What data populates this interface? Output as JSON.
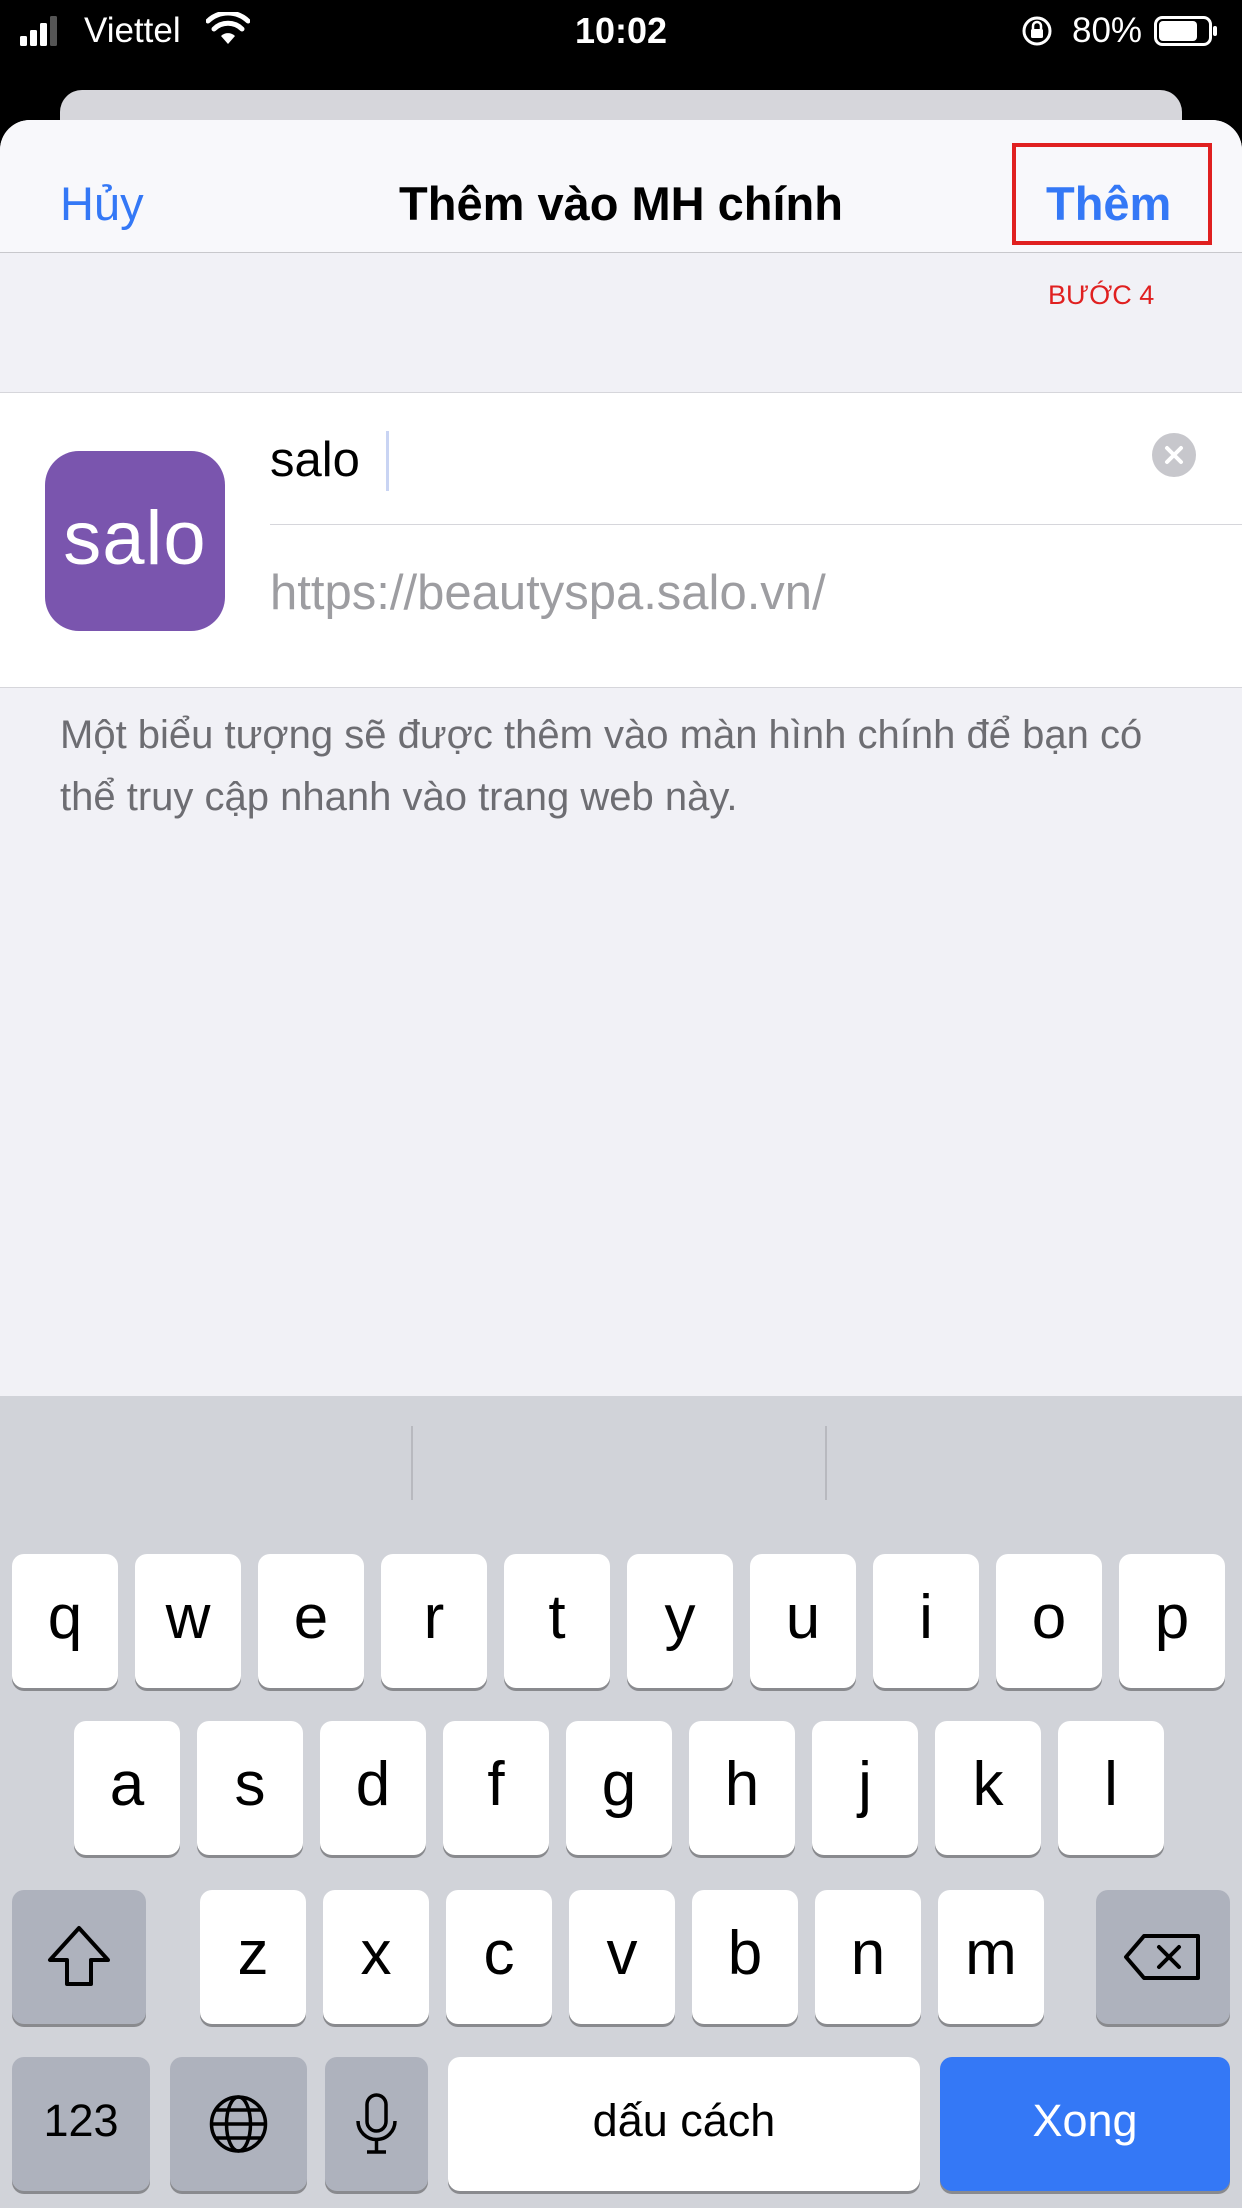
{
  "status": {
    "carrier": "Viettel",
    "time": "10:02",
    "battery_percent": "80%",
    "battery_level": 0.8
  },
  "nav": {
    "cancel": "Hủy",
    "title": "Thêm vào MH chính",
    "add": "Thêm"
  },
  "annotation": {
    "step": "BƯỚC 4",
    "color": "#e02020"
  },
  "app": {
    "icon_text": "salo",
    "icon_color": "#7a55ae",
    "name_value": "salo",
    "url": "https://beautyspa.salo.vn/"
  },
  "description": "Một biểu tượng sẽ được thêm vào màn hình chính để bạn có thể truy cập nhanh vào trang web này.",
  "keyboard": {
    "row1": [
      "q",
      "w",
      "e",
      "r",
      "t",
      "y",
      "u",
      "i",
      "o",
      "p"
    ],
    "row2": [
      "a",
      "s",
      "d",
      "f",
      "g",
      "h",
      "j",
      "k",
      "l"
    ],
    "row3": [
      "z",
      "x",
      "c",
      "v",
      "b",
      "n",
      "m"
    ],
    "numbers": "123",
    "space": "dấu cách",
    "done": "Xong",
    "accent_color": "#3478f6"
  }
}
